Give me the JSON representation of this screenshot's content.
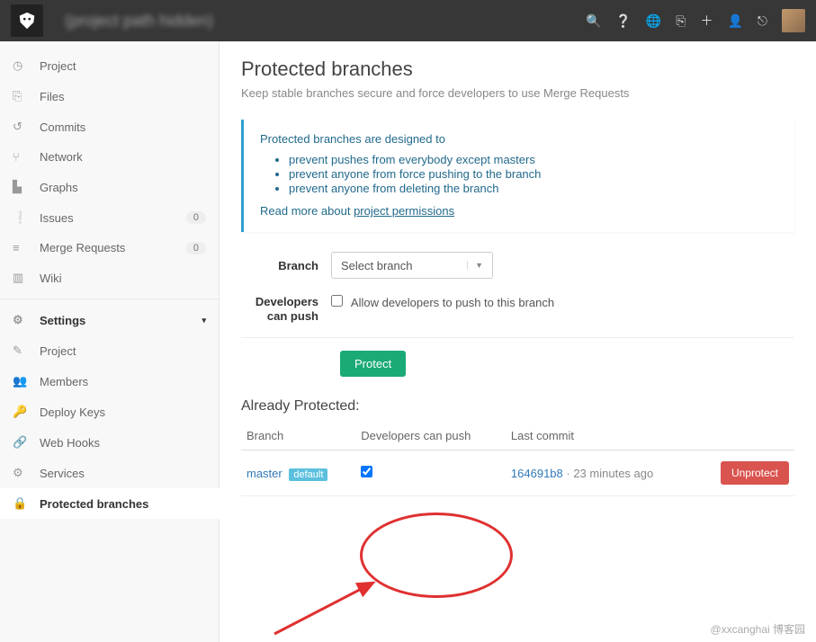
{
  "topbar": {
    "title": "(project path hidden)",
    "icons": [
      "search",
      "help",
      "globe",
      "copy",
      "plus",
      "user",
      "signout"
    ]
  },
  "sidebar": {
    "items": [
      {
        "icon": "◷",
        "label": "Project"
      },
      {
        "icon": "⎘",
        "label": "Files"
      },
      {
        "icon": "↺",
        "label": "Commits"
      },
      {
        "icon": "⑂",
        "label": "Network"
      },
      {
        "icon": "▙",
        "label": "Graphs"
      },
      {
        "icon": "❕",
        "label": "Issues",
        "badge": "0"
      },
      {
        "icon": "≡",
        "label": "Merge Requests",
        "badge": "0"
      },
      {
        "icon": "▥",
        "label": "Wiki"
      }
    ],
    "settings": {
      "label": "Settings"
    },
    "settings_items": [
      {
        "icon": "✎",
        "label": "Project"
      },
      {
        "icon": "👥",
        "label": "Members"
      },
      {
        "icon": "🔑",
        "label": "Deploy Keys"
      },
      {
        "icon": "🔗",
        "label": "Web Hooks"
      },
      {
        "icon": "⚙",
        "label": "Services"
      },
      {
        "icon": "🔒",
        "label": "Protected branches",
        "active": true
      }
    ]
  },
  "main": {
    "title": "Protected branches",
    "subtitle": "Keep stable branches secure and force developers to use Merge Requests",
    "info": {
      "lead": "Protected branches are designed to",
      "points": [
        "prevent pushes from everybody except masters",
        "prevent anyone from force pushing to the branch",
        "prevent anyone from deleting the branch"
      ],
      "readmore_prefix": "Read more about ",
      "readmore_link": "project permissions"
    },
    "form": {
      "branch_label": "Branch",
      "branch_placeholder": "Select branch",
      "devpush_label": "Developers can push",
      "devpush_checkbox": "Allow developers to push to this branch",
      "protect_btn": "Protect"
    },
    "table": {
      "heading": "Already Protected:",
      "cols": [
        "Branch",
        "Developers can push",
        "Last commit",
        ""
      ],
      "rows": [
        {
          "branch": "master",
          "default": "default",
          "devpush": true,
          "hash": "164691b8",
          "ago": "23 minutes ago",
          "unprotect": "Unprotect"
        }
      ]
    }
  },
  "watermark": "@xxcanghai 博客园"
}
